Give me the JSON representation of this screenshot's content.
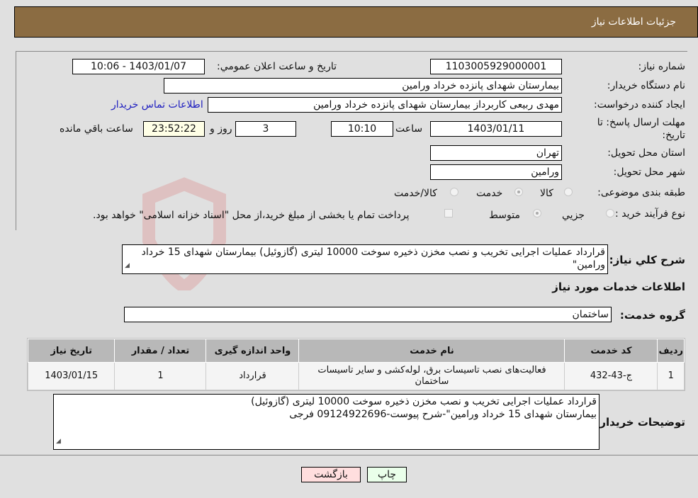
{
  "header": {
    "title": "جزئیات اطلاعات نیاز"
  },
  "form": {
    "need_number_label": "شماره نیاز:",
    "need_number": "1103005929000001",
    "announce_label": "تاریخ و ساعت اعلان عمومي:",
    "announce_value": "1403/01/07 - 10:06",
    "buyer_org_label": "نام دستگاه خریدار:",
    "buyer_org": "بیمارستان شهدای پانزده خرداد ورامین",
    "creator_label": "ایجاد کننده درخواست:",
    "creator": "مهدی ربیعی کاربرداز بیمارستان شهدای پانزده خرداد ورامین",
    "contact_link": "اطلاعات تماس خریدار",
    "deadline_label_line1": "مهلت ارسال پاسخ: تا",
    "deadline_label_line2": "تاریخ:",
    "deadline_date": "1403/01/11",
    "time_label": "ساعت",
    "deadline_time": "10:10",
    "days_value": "3",
    "days_label": "روز و",
    "remaining_value": "23:52:22",
    "remaining_label": "ساعت باقي مانده",
    "province_label": "استان محل تحویل:",
    "province": "تهران",
    "city_label": "شهر محل تحویل:",
    "city": "ورامین",
    "category_label": "طبقه بندی موضوعی:",
    "category_options": [
      {
        "label": "کالا",
        "selected": false
      },
      {
        "label": "خدمت",
        "selected": true
      },
      {
        "label": "کالا/خدمت",
        "selected": false
      }
    ],
    "process_label": "نوع فرآیند خرید :",
    "process_options": [
      {
        "label": "جزيي",
        "selected": false
      },
      {
        "label": "متوسط",
        "selected": true
      }
    ],
    "treasury_note": "پرداخت تمام یا بخشی از مبلغ خرید،از محل \"اسناد خزانه اسلامی\" خواهد بود."
  },
  "description": {
    "label": "شرح کلي نیاز:",
    "value": "قرارداد عملیات  اجرایی تخریب و نصب  مخزن ذخیره سوخت 10000 لیتری (گازوئیل) بیمارستان شهدای 15 خرداد ورامین\""
  },
  "services": {
    "section_title": "اطلاعات خدمات مورد نیاز",
    "group_label": "گروه خدمت:",
    "group_value": "ساختمان",
    "columns": [
      "ردیف",
      "کد خدمت",
      "نام خدمت",
      "واحد اندازه گیری",
      "تعداد / مقدار",
      "تاریخ نیاز"
    ],
    "rows": [
      {
        "row": "1",
        "code": "ج-43-432",
        "name": "فعالیت‌های نصب تاسیسات برق، لوله‌کشی و سایر تاسیسات ساختمان",
        "unit": "قرارداد",
        "qty": "1",
        "date": "1403/01/15"
      }
    ]
  },
  "buyer_notes": {
    "label": "توضیحات خریدار:",
    "line1": "قرارداد عملیات  اجرایی تخریب و نصب  مخزن ذخیره سوخت 10000 لیتری (گازوئیل)",
    "line2": "بیمارستان شهدای 15 خرداد ورامین\"-شرح پیوست-09124922696 فرجی"
  },
  "buttons": {
    "print": "چاپ",
    "back": "بازگشت"
  },
  "colors": {
    "header_bg": "#8b6c42",
    "print_bg": "#eaffea",
    "back_bg": "#ffdede",
    "link": "#2020c0"
  }
}
